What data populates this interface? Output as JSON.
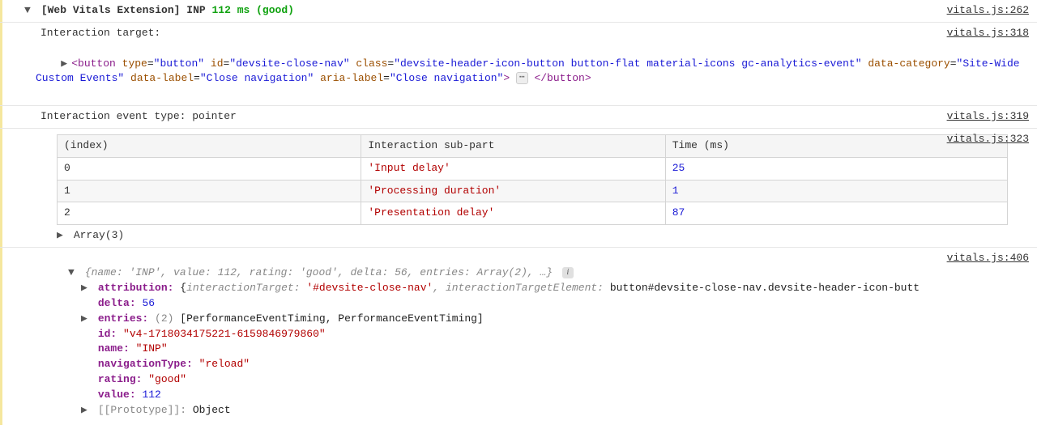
{
  "header": {
    "prefix": "[Web Vitals Extension]",
    "metric": "INP",
    "value": "112 ms",
    "rating": "(good)",
    "source": "vitals.js:262"
  },
  "target": {
    "label": "Interaction target:",
    "source": "vitals.js:318",
    "elem": {
      "tag_open": "<button",
      "attrs": [
        {
          "k": "type",
          "v": "\"button\""
        },
        {
          "k": "id",
          "v": "\"devsite-close-nav\""
        },
        {
          "k": "class",
          "v": "\"devsite-header-icon-button button-flat material-icons gc-analytics-event\""
        },
        {
          "k": "data-category",
          "v": "\"Site-Wide Custom Events\""
        },
        {
          "k": "data-label",
          "v": "\"Close navigation\""
        },
        {
          "k": "aria-label",
          "v": "\"Close navigation\""
        }
      ],
      "close_angle": ">",
      "tag_close": "</button>"
    }
  },
  "event_type": {
    "label": "Interaction event type: pointer",
    "source": "vitals.js:319"
  },
  "table_block": {
    "source": "vitals.js:323",
    "headers": {
      "index": "(index)",
      "sub": "Interaction sub-part",
      "time": "Time (ms)"
    },
    "rows": [
      {
        "i": "0",
        "sub": "'Input delay'",
        "t": "25"
      },
      {
        "i": "1",
        "sub": "'Processing duration'",
        "t": "1"
      },
      {
        "i": "2",
        "sub": "'Presentation delay'",
        "t": "87"
      }
    ],
    "array_summary": "Array(3)"
  },
  "obj": {
    "source": "vitals.js:406",
    "summary": "{name: 'INP', value: 112, rating: 'good', delta: 56, entries: Array(2), …}",
    "props": {
      "attribution_key": "attribution:",
      "attribution_val_open": "{",
      "attribution_k1": "interactionTarget:",
      "attribution_v1": "'#devsite-close-nav'",
      "attribution_sep": ", ",
      "attribution_k2": "interactionTargetElement:",
      "attribution_v2": "button#devsite-close-nav.devsite-header-icon-butt",
      "delta_key": "delta:",
      "delta_val": "56",
      "entries_key": "entries:",
      "entries_count": "(2)",
      "entries_val": "[PerformanceEventTiming, PerformanceEventTiming]",
      "id_key": "id:",
      "id_val": "\"v4-1718034175221-6159846979860\"",
      "name_key": "name:",
      "name_val": "\"INP\"",
      "nav_key": "navigationType:",
      "nav_val": "\"reload\"",
      "rating_key": "rating:",
      "rating_val": "\"good\"",
      "value_key": "value:",
      "value_val": "112",
      "proto_key": "[[Prototype]]:",
      "proto_val": "Object"
    }
  },
  "chart_data": {
    "type": "table",
    "title": "INP interaction breakdown",
    "columns": [
      "(index)",
      "Interaction sub-part",
      "Time (ms)"
    ],
    "rows": [
      [
        0,
        "Input delay",
        25
      ],
      [
        1,
        "Processing duration",
        1
      ],
      [
        2,
        "Presentation delay",
        87
      ]
    ]
  }
}
